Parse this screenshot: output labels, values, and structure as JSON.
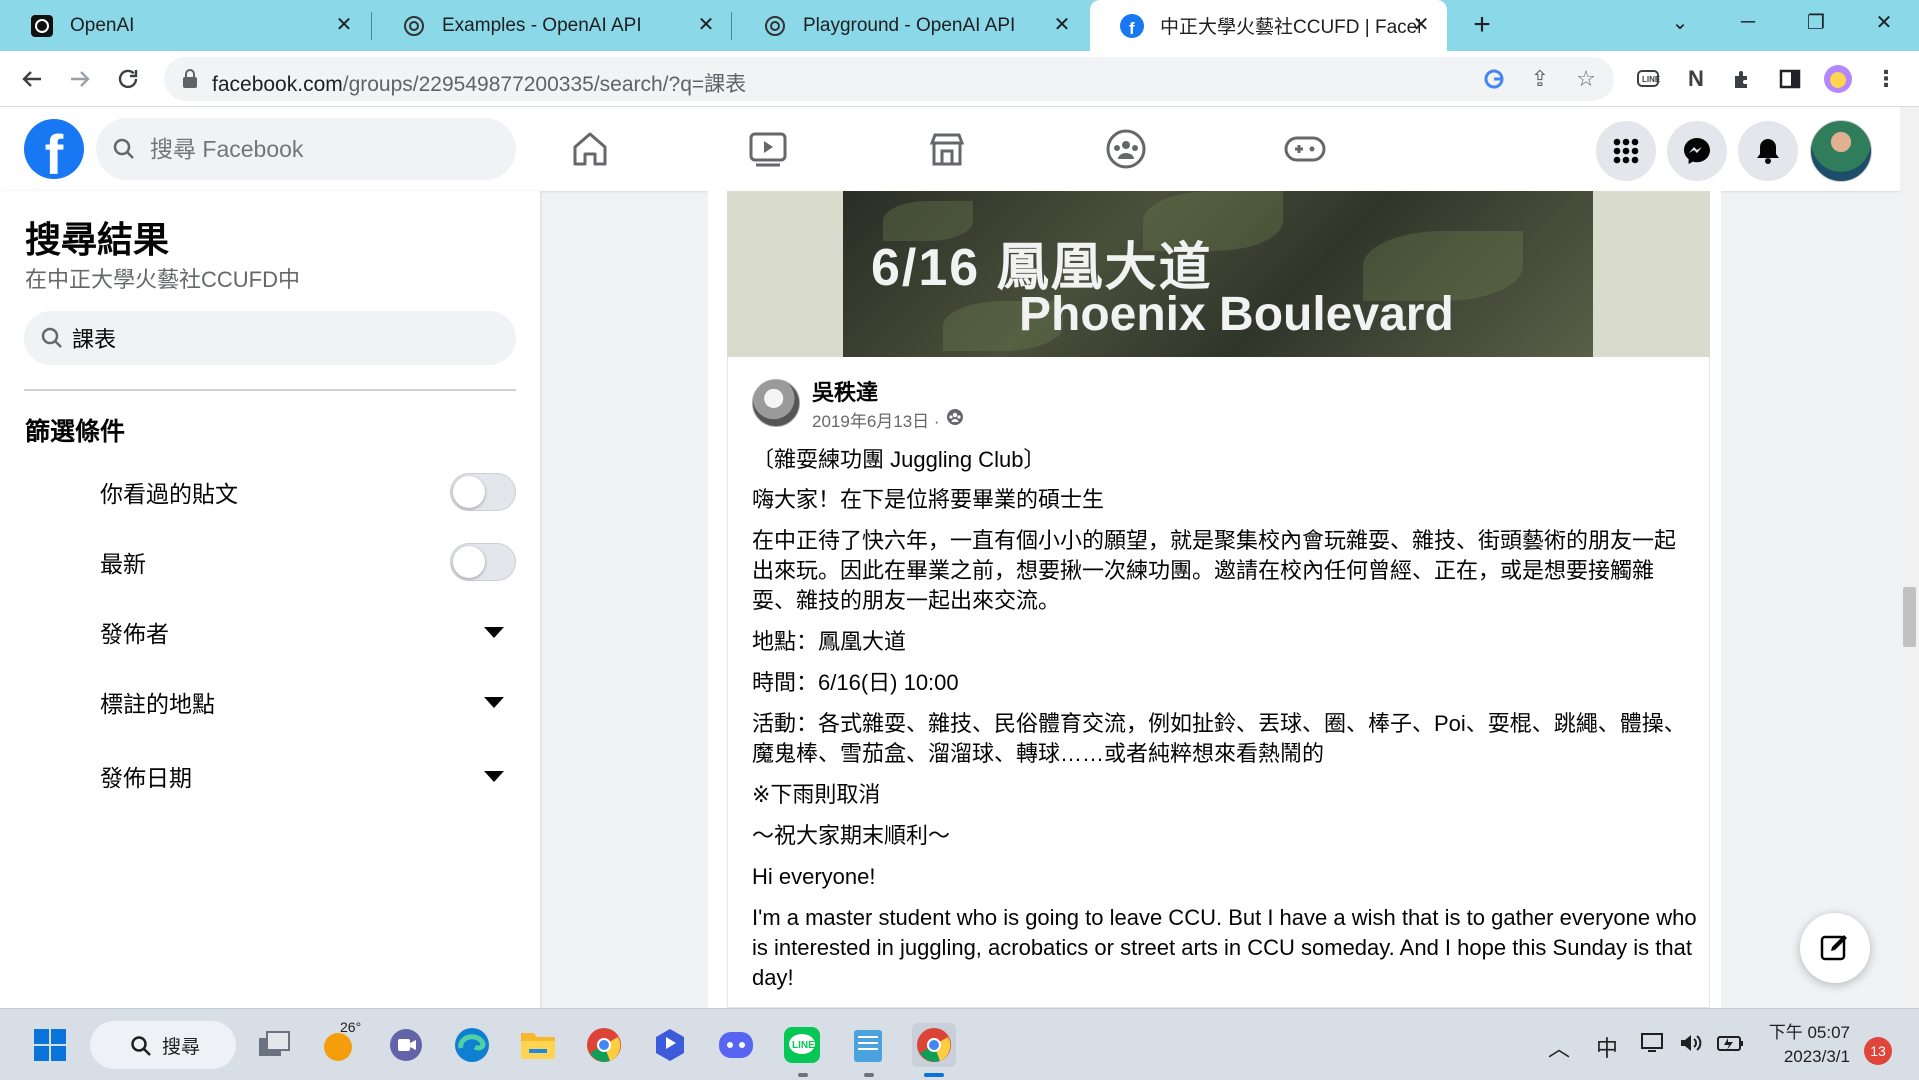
{
  "browser": {
    "tabs": [
      {
        "title": "OpenAI",
        "icon": "openai-icon"
      },
      {
        "title": "Examples - OpenAI API",
        "icon": "openai-icon"
      },
      {
        "title": "Playground - OpenAI API",
        "icon": "openai-icon"
      },
      {
        "title": "中正大學火藝社CCUFD | Facebook",
        "icon": "facebook-icon",
        "active": true
      }
    ],
    "url_domain": "facebook.com",
    "url_path": "/groups/229549877200335/search/?q=課表"
  },
  "facebook": {
    "search_placeholder": "搜尋 Facebook",
    "nav": [
      "home-icon",
      "watch-icon",
      "marketplace-icon",
      "groups-icon",
      "gaming-icon"
    ]
  },
  "sidebar": {
    "title": "搜尋結果",
    "subtitle": "在中正大學火藝社CCUFD中",
    "search_value": "課表",
    "filters_heading": "篩選條件",
    "filters": [
      {
        "label": "你看過的貼文",
        "type": "toggle",
        "on": false
      },
      {
        "label": "最新",
        "type": "toggle",
        "on": false
      },
      {
        "label": "發佈者",
        "type": "dropdown"
      },
      {
        "label": "標註的地點",
        "type": "dropdown"
      },
      {
        "label": "發佈日期",
        "type": "dropdown"
      }
    ]
  },
  "post": {
    "cover_line1": "6/16 鳳凰大道",
    "cover_line2": "Phoenix Boulevard",
    "author": "吳秩達",
    "date": "2019年6月13日 ·",
    "paragraphs": [
      "〔雜耍練功團 Juggling Club〕",
      "嗨大家！在下是位將要畢業的碩士生",
      "在中正待了快六年，一直有個小小的願望，就是聚集校內會玩雜耍、雜技、街頭藝術的朋友一起出來玩。因此在畢業之前，想要揪一次練功團。邀請在校內任何曾經、正在，或是想要接觸雜耍、雜技的朋友一起出來交流。",
      "地點：鳳凰大道",
      "時間：6/16(日) 10:00",
      "活動：各式雜耍、雜技、民俗體育交流，例如扯鈴、丟球、圈、棒子、Poi、耍棍、跳繩、體操、魔鬼棒、雪茄盒、溜溜球、轉球……或者純粹想來看熱鬧的",
      "※下雨則取消",
      "～祝大家期末順利～",
      "Hi everyone!",
      "I'm a master student who is going to leave CCU. But I have a wish that is to gather everyone who is  interested in juggling, acrobatics or street arts in CCU someday. And I hope this Sunday is that day!"
    ]
  },
  "taskbar": {
    "search_label": "搜尋",
    "weather": "26°",
    "ime": "中",
    "time": "下午 05:07",
    "date": "2023/3/1",
    "notifications": "13"
  },
  "colors": {
    "fb_blue": "#1877f2",
    "tab_strip": "#8bd8e8"
  }
}
